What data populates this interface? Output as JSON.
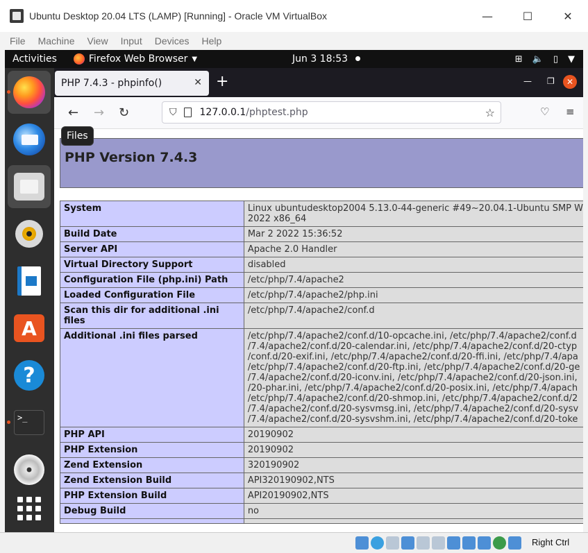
{
  "vbox": {
    "title": "Ubuntu Desktop 20.04 LTS (LAMP) [Running] - Oracle VM VirtualBox",
    "menu": [
      "File",
      "Machine",
      "View",
      "Input",
      "Devices",
      "Help"
    ],
    "host_key": "Right Ctrl"
  },
  "gnome": {
    "activities": "Activities",
    "app_menu": "Firefox Web Browser",
    "clock": "Jun 3  18:53"
  },
  "dock": {
    "tooltip": "Files",
    "items": [
      "Firefox",
      "Thunderbird Mail",
      "Files",
      "Rhythmbox",
      "LibreOffice Writer",
      "Ubuntu Software",
      "Help",
      "Terminal",
      "DVD",
      "Show Applications"
    ],
    "terminal_prompt": ">_"
  },
  "firefox": {
    "tab_title": "PHP 7.4.3 - phpinfo()",
    "url_host": "127.0.0.1",
    "url_path": "/phptest.php"
  },
  "phpinfo": {
    "title": "PHP Version 7.4.3",
    "rows": [
      {
        "key": "System",
        "lines": [
          "Linux ubuntudesktop2004 5.13.0-44-generic #49~20.04.1-Ubuntu SMP W",
          "2022 x86_64"
        ]
      },
      {
        "key": "Build Date",
        "lines": [
          "Mar 2 2022 15:36:52"
        ]
      },
      {
        "key": "Server API",
        "lines": [
          "Apache 2.0 Handler"
        ]
      },
      {
        "key": "Virtual Directory Support",
        "lines": [
          "disabled"
        ]
      },
      {
        "key": "Configuration File (php.ini) Path",
        "lines": [
          "/etc/php/7.4/apache2"
        ]
      },
      {
        "key": "Loaded Configuration File",
        "lines": [
          "/etc/php/7.4/apache2/php.ini"
        ]
      },
      {
        "key": "Scan this dir for additional .ini files",
        "lines": [
          "/etc/php/7.4/apache2/conf.d"
        ]
      },
      {
        "key": "Additional .ini files parsed",
        "lines": [
          "/etc/php/7.4/apache2/conf.d/10-opcache.ini, /etc/php/7.4/apache2/conf.d",
          "/7.4/apache2/conf.d/20-calendar.ini, /etc/php/7.4/apache2/conf.d/20-ctyp",
          "/conf.d/20-exif.ini, /etc/php/7.4/apache2/conf.d/20-ffi.ini, /etc/php/7.4/apa",
          "/etc/php/7.4/apache2/conf.d/20-ftp.ini, /etc/php/7.4/apache2/conf.d/20-ge",
          "/7.4/apache2/conf.d/20-iconv.ini, /etc/php/7.4/apache2/conf.d/20-json.ini,",
          "/20-phar.ini, /etc/php/7.4/apache2/conf.d/20-posix.ini, /etc/php/7.4/apach",
          "/etc/php/7.4/apache2/conf.d/20-shmop.ini, /etc/php/7.4/apache2/conf.d/2",
          "/7.4/apache2/conf.d/20-sysvmsg.ini, /etc/php/7.4/apache2/conf.d/20-sysv",
          "/7.4/apache2/conf.d/20-sysvshm.ini, /etc/php/7.4/apache2/conf.d/20-toke"
        ]
      },
      {
        "key": "PHP API",
        "lines": [
          "20190902"
        ]
      },
      {
        "key": "PHP Extension",
        "lines": [
          "20190902"
        ]
      },
      {
        "key": "Zend Extension",
        "lines": [
          "320190902"
        ]
      },
      {
        "key": "Zend Extension Build",
        "lines": [
          "API320190902,NTS"
        ]
      },
      {
        "key": "PHP Extension Build",
        "lines": [
          "API20190902,NTS"
        ]
      },
      {
        "key": "Debug Build",
        "lines": [
          "no"
        ]
      },
      {
        "key": "",
        "lines": [
          ""
        ]
      }
    ]
  },
  "colors": {
    "php_header": "#9999cc",
    "php_key_cell": "#ccccff",
    "php_value_cell": "#dddddd",
    "ubuntu_orange": "#e95420"
  }
}
